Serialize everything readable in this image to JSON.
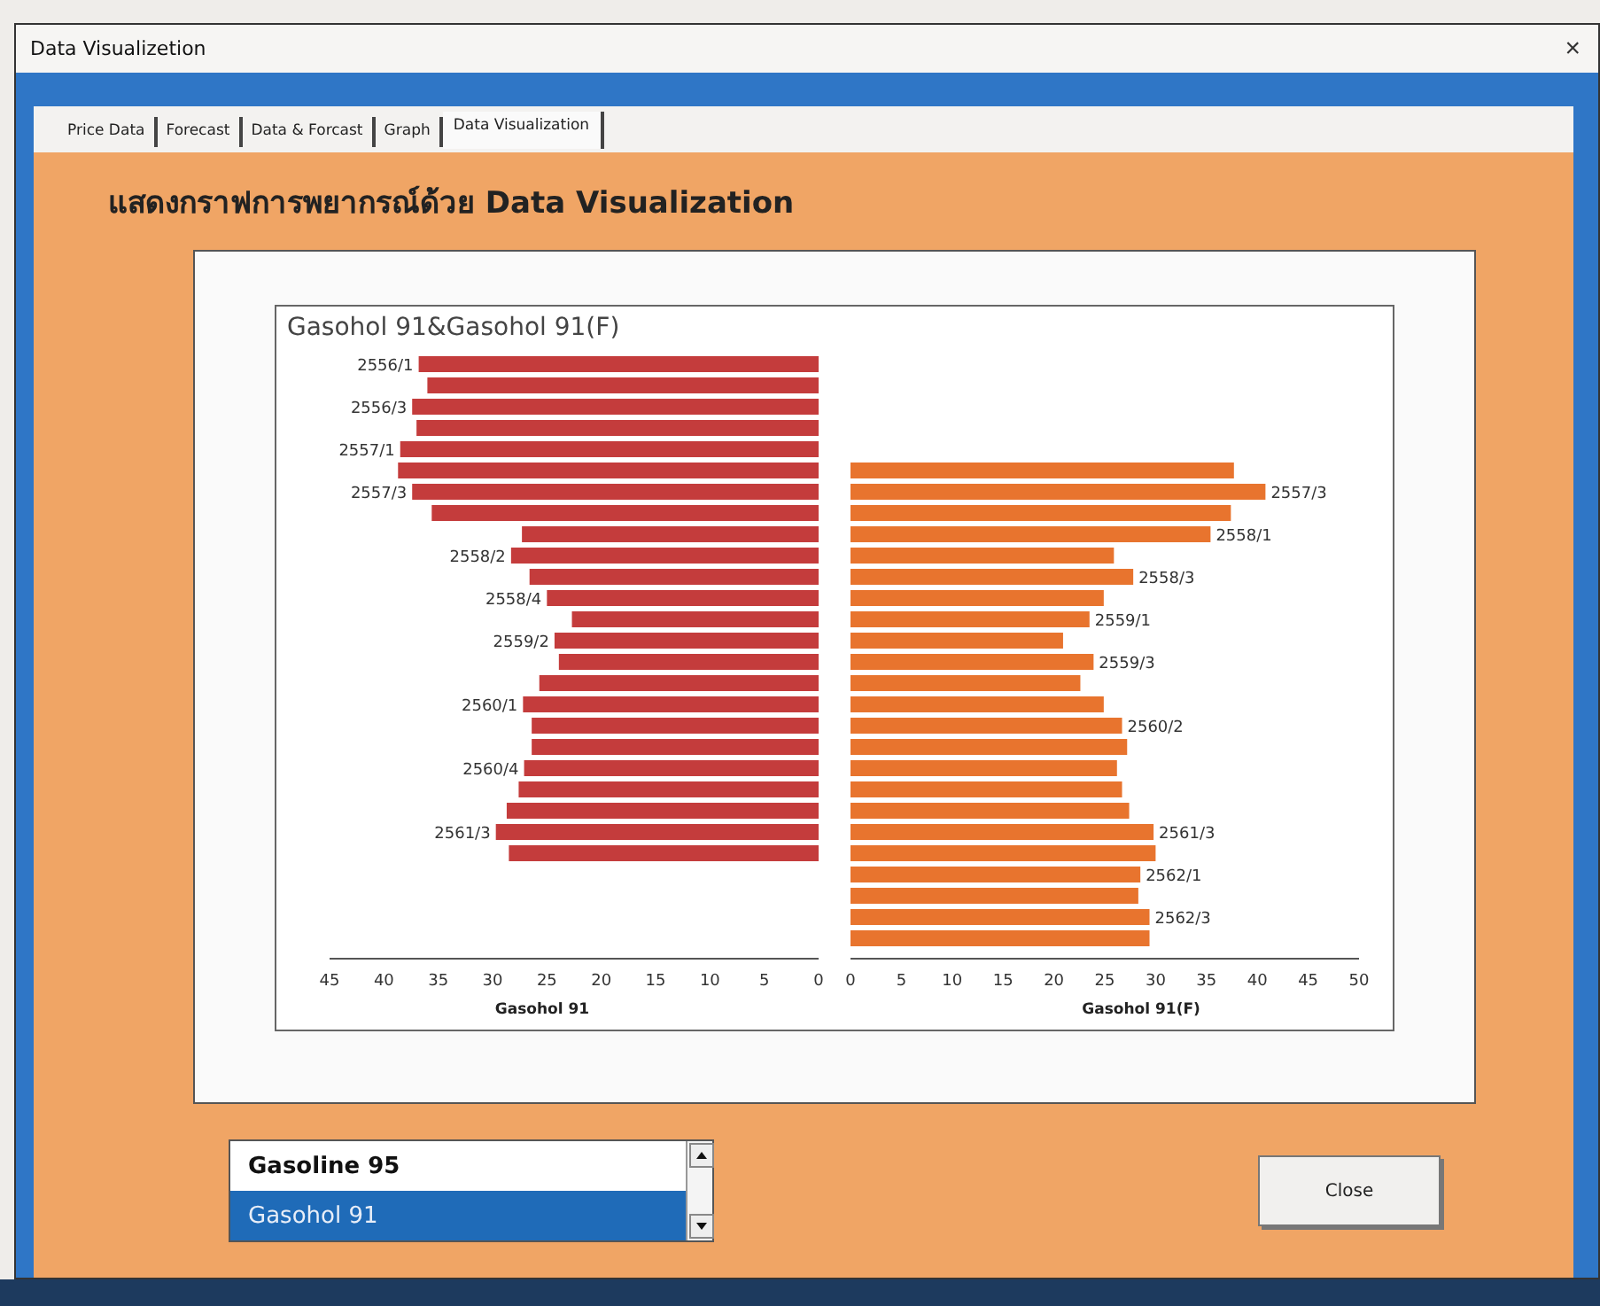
{
  "window": {
    "title": "Data Visualizetion",
    "close": "×"
  },
  "tabs": [
    {
      "label": "Price Data",
      "selected": false
    },
    {
      "label": "Forecast",
      "selected": false
    },
    {
      "label": "Data & Forcast",
      "selected": false
    },
    {
      "label": "Graph",
      "selected": false
    },
    {
      "label": "Data Visualization",
      "selected": true
    }
  ],
  "heading": "แสดงกราฟการพยากรณ์ด้วย Data Visualization",
  "chart": {
    "title": "Gasohol 91&Gasohol 91(F)",
    "panels": [
      {
        "chart_data": {
          "type": "bar",
          "orientation": "horizontal",
          "xlabel": "Gasohol 91",
          "xlim": [
            45,
            0
          ],
          "xticks": [
            45,
            40,
            35,
            30,
            25,
            20,
            15,
            10,
            5,
            0
          ],
          "categories": [
            "2556/1",
            null,
            "2556/3",
            null,
            "2557/1",
            null,
            "2557/3",
            null,
            null,
            "2558/2",
            null,
            "2558/4",
            null,
            "2559/2",
            null,
            null,
            "2560/1",
            null,
            null,
            "2560/4",
            null,
            null,
            "2561/3",
            null,
            null,
            null,
            null,
            null
          ],
          "series": [
            {
              "color": "#c43c3c",
              "values": [
                36.8,
                36.0,
                37.4,
                37.0,
                38.5,
                38.7,
                37.4,
                35.6,
                27.3,
                28.3,
                26.6,
                25.0,
                22.7,
                24.3,
                23.9,
                25.7,
                27.2,
                26.4,
                26.4,
                27.1,
                27.6,
                28.7,
                29.7,
                28.5,
                null,
                null,
                null,
                null
              ]
            }
          ]
        }
      },
      {
        "chart_data": {
          "type": "bar",
          "orientation": "horizontal",
          "xlabel": "Gasohol 91(F)",
          "xlim": [
            0,
            50
          ],
          "xticks": [
            0,
            5,
            10,
            15,
            20,
            25,
            30,
            35,
            40,
            45,
            50
          ],
          "categories": [
            null,
            null,
            null,
            null,
            null,
            null,
            "2557/3",
            null,
            "2558/1",
            null,
            "2558/3",
            null,
            "2559/1",
            null,
            "2559/3",
            null,
            null,
            "2560/2",
            null,
            null,
            null,
            null,
            "2561/3",
            null,
            "2562/1",
            null,
            "2562/3",
            null
          ],
          "series": [
            {
              "color": "#e8742e",
              "values": [
                null,
                null,
                null,
                null,
                null,
                37.7,
                40.8,
                37.4,
                35.4,
                25.9,
                27.8,
                24.9,
                23.5,
                20.9,
                23.9,
                22.6,
                24.9,
                26.7,
                27.2,
                26.2,
                26.7,
                27.4,
                29.8,
                30.0,
                28.5,
                28.3,
                29.4,
                29.4
              ]
            }
          ]
        }
      }
    ]
  },
  "fuel_list": {
    "items": [
      {
        "label": "Gasoline 95",
        "selected": false
      },
      {
        "label": "Gasohol 91",
        "selected": true
      }
    ]
  },
  "buttons": [
    {
      "label": "Close"
    }
  ]
}
